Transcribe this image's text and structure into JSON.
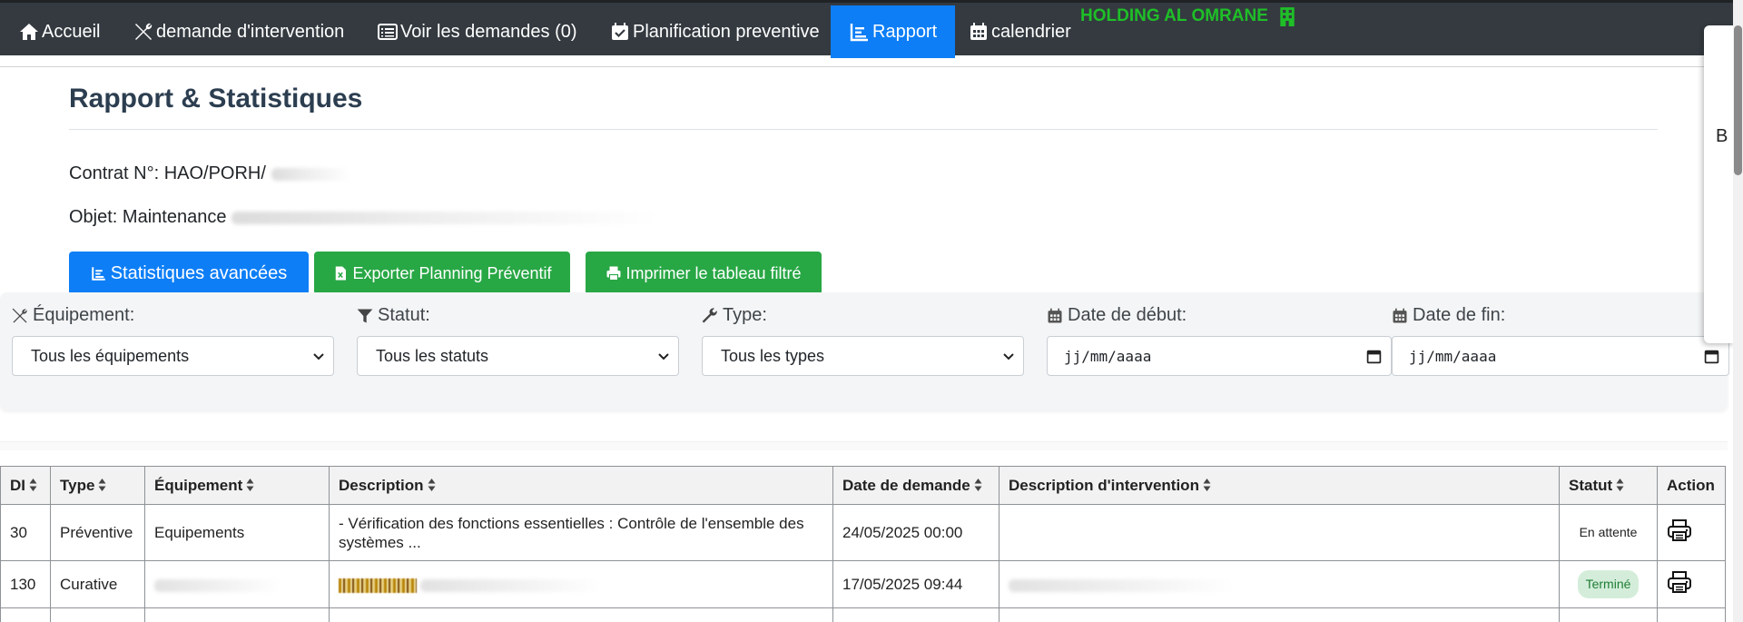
{
  "nav": {
    "items": [
      {
        "label": "Accueil",
        "icon": "home-icon",
        "active": false
      },
      {
        "label": "demande d'intervention",
        "icon": "tools-icon",
        "active": false
      },
      {
        "label": "Voir les demandes (0)",
        "icon": "list-icon",
        "active": false
      },
      {
        "label": "Planification preventive",
        "icon": "calendar-check-icon",
        "active": false
      },
      {
        "label": "Rapport",
        "icon": "chart-icon",
        "active": true
      },
      {
        "label": "calendrier",
        "icon": "calendar-icon",
        "active": false
      }
    ],
    "brand": "HOLDING AL OMRANE",
    "brand_icon": "building-icon",
    "colors": {
      "bar": "#343a40",
      "active": "#0d7ef6",
      "brand": "#1fbf28"
    }
  },
  "page": {
    "title": "Rapport & Statistiques",
    "contract_label": "Contrat N°: HAO/PORH/",
    "object_label": "Objet: Maintenance"
  },
  "buttons": {
    "stats": "Statistiques avancées",
    "export": "Exporter Planning Préventif",
    "print": "Imprimer le tableau filtré"
  },
  "filters": {
    "equipment": {
      "label": "Équipement:",
      "value": "Tous les équipements"
    },
    "status": {
      "label": "Statut:",
      "value": "Tous les statuts"
    },
    "type": {
      "label": "Type:",
      "value": "Tous les types"
    },
    "start_date": {
      "label": "Date de début:",
      "placeholder": "jj/mm/aaaa"
    },
    "end_date": {
      "label": "Date de fin:",
      "placeholder": "jj/mm/aaaa"
    }
  },
  "table": {
    "headers": [
      "DI",
      "Type",
      "Équipement",
      "Description",
      "Date de demande",
      "Description d'intervention",
      "Statut",
      "Action"
    ],
    "rows": [
      {
        "di": "30",
        "type": "Préventive",
        "equipment": "Equipements",
        "description": "- Vérification des fonctions essentielles : Contrôle de l'ensemble des systèmes ...",
        "date": "24/05/2025 00:00",
        "intervention": "",
        "status": "En attente"
      },
      {
        "di": "130",
        "type": "Curative",
        "equipment": "",
        "description": "",
        "date": "17/05/2025 09:44",
        "intervention": "",
        "status": "Terminé"
      }
    ]
  },
  "side_panel": {
    "text": "B"
  }
}
